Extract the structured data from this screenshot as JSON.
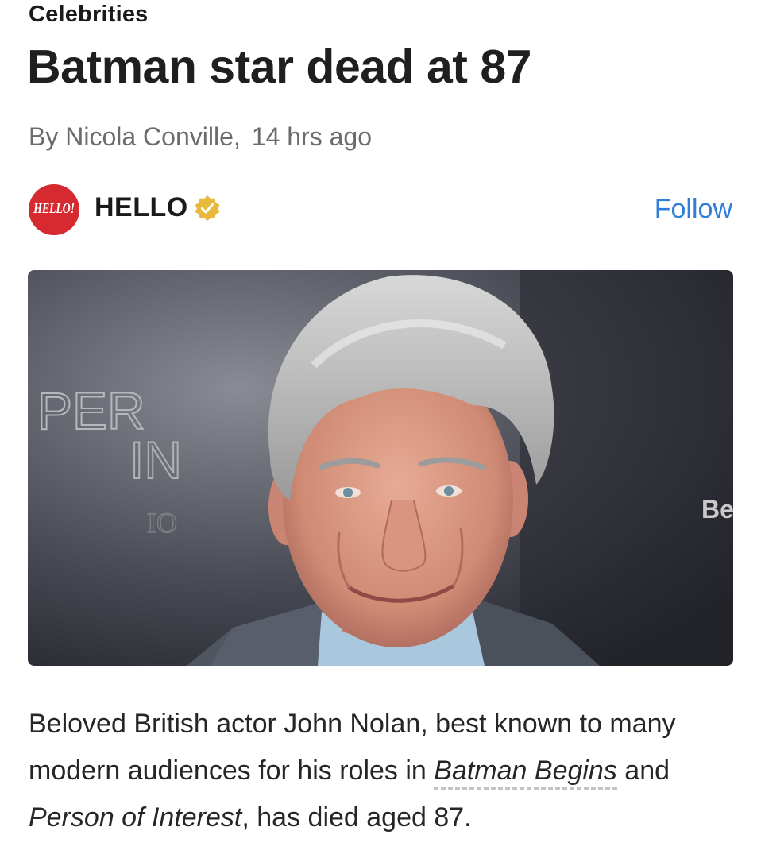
{
  "article": {
    "category": "Celebrities",
    "headline": "Batman star dead at 87",
    "byline_author": "By Nicola Conville,",
    "byline_time": "14 hrs ago"
  },
  "publisher": {
    "logo_text": "HELLO!",
    "name": "HELLO",
    "verified_icon": "verified-badge-icon",
    "follow_label": "Follow",
    "brand_color": "#d62a30",
    "verified_color": "#e8b93a",
    "follow_color": "#2f7fd8"
  },
  "hero_image": {
    "backdrop_text_1": "PER",
    "backdrop_text_2": "IN",
    "backdrop_text_3": "IO",
    "backdrop_text_right": "Be"
  },
  "body": {
    "p1_a": "Beloved British actor John Nolan, best known to many modern audiences for his roles in ",
    "p1_link1": "Batman Begins",
    "p1_b": " and ",
    "p1_link2": "Person of Interest",
    "p1_c": ", has died aged 87."
  }
}
